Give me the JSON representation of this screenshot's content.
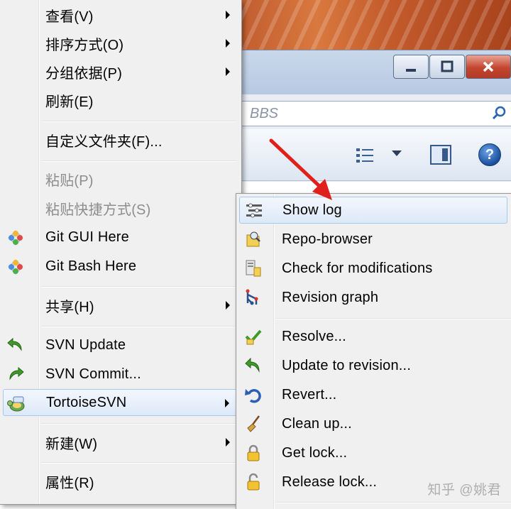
{
  "background": {
    "address_text": "BBS",
    "window_buttons": [
      "minimize",
      "maximize",
      "close"
    ]
  },
  "main_menu": {
    "items": [
      {
        "label": "查看(V)",
        "submenu": true,
        "enabled": true
      },
      {
        "label": "排序方式(O)",
        "submenu": true,
        "enabled": true
      },
      {
        "label": "分组依据(P)",
        "submenu": true,
        "enabled": true
      },
      {
        "label": "刷新(E)",
        "submenu": false,
        "enabled": true
      },
      {
        "label": "自定义文件夹(F)...",
        "submenu": false,
        "enabled": true
      },
      {
        "label": "粘贴(P)",
        "submenu": false,
        "enabled": false
      },
      {
        "label": "粘贴快捷方式(S)",
        "submenu": false,
        "enabled": false
      },
      {
        "label": "Git GUI Here",
        "submenu": false,
        "enabled": true,
        "icon": "git-icon"
      },
      {
        "label": "Git Bash Here",
        "submenu": false,
        "enabled": true,
        "icon": "git-icon"
      },
      {
        "label": "共享(H)",
        "submenu": true,
        "enabled": true
      },
      {
        "label": "SVN Update",
        "submenu": false,
        "enabled": true,
        "icon": "svn-update-icon"
      },
      {
        "label": "SVN Commit...",
        "submenu": false,
        "enabled": true,
        "icon": "svn-commit-icon"
      },
      {
        "label": "TortoiseSVN",
        "submenu": true,
        "enabled": true,
        "icon": "tortoise-icon",
        "highlighted": true
      },
      {
        "label": "新建(W)",
        "submenu": true,
        "enabled": true
      },
      {
        "label": "属性(R)",
        "submenu": false,
        "enabled": true
      }
    ]
  },
  "svn_submenu": {
    "items": [
      {
        "label": "Show log",
        "icon": "log-icon",
        "highlighted": true
      },
      {
        "label": "Repo-browser",
        "icon": "repo-browser-icon"
      },
      {
        "label": "Check for modifications",
        "icon": "check-modifications-icon"
      },
      {
        "label": "Revision graph",
        "icon": "revision-graph-icon"
      },
      {
        "label": "Resolve...",
        "icon": "resolve-icon"
      },
      {
        "label": "Update to revision...",
        "icon": "update-revision-icon"
      },
      {
        "label": "Revert...",
        "icon": "revert-icon"
      },
      {
        "label": "Clean up...",
        "icon": "cleanup-icon"
      },
      {
        "label": "Get lock...",
        "icon": "lock-icon"
      },
      {
        "label": "Release lock...",
        "icon": "unlock-icon"
      }
    ]
  },
  "watermark": "知乎 @姚君",
  "colors": {
    "menu_bg": "#f0f0f0",
    "highlight_border": "#a8c7ee",
    "arrow": "#e0201b"
  }
}
